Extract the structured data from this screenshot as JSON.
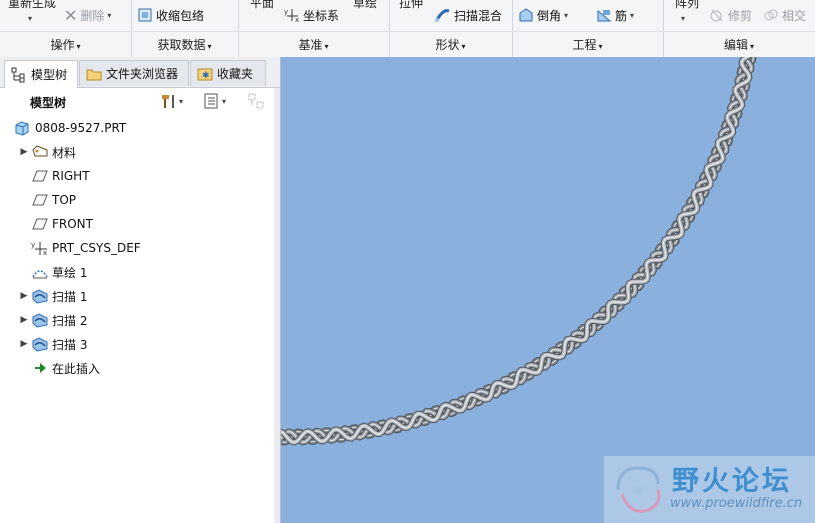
{
  "ribbon": {
    "groups": [
      {
        "title": "操作",
        "buttons": {
          "regenerate": "重新生成",
          "delete": "删除"
        }
      },
      {
        "title": "获取数据",
        "buttons": {
          "shrinkwrap": "收缩包络"
        }
      },
      {
        "title": "基准",
        "buttons": {
          "plane": "平面",
          "csys": "坐标系",
          "sketch": "草绘"
        }
      },
      {
        "title": "形状",
        "buttons": {
          "extrude": "拉伸",
          "swept_blend": "扫描混合"
        }
      },
      {
        "title": "工程",
        "buttons": {
          "chamfer": "倒角",
          "rib": "筋"
        }
      },
      {
        "title": "编辑",
        "buttons": {
          "pattern": "阵列",
          "trim": "修剪",
          "intersect": "相交"
        }
      }
    ]
  },
  "left_panel": {
    "tabs": [
      {
        "label": "模型树",
        "icon": "model-tree-icon",
        "active": true
      },
      {
        "label": "文件夹浏览器",
        "icon": "folder-icon",
        "active": false
      },
      {
        "label": "收藏夹",
        "icon": "favorites-icon",
        "active": false
      }
    ],
    "tree_title": "模型树",
    "tree": [
      {
        "label": "0808-9527.PRT",
        "icon": "part-icon",
        "expandable": false
      },
      {
        "label": "材料",
        "icon": "material-icon",
        "expandable": true
      },
      {
        "label": "RIGHT",
        "icon": "datum-plane-icon",
        "expandable": false
      },
      {
        "label": "TOP",
        "icon": "datum-plane-icon",
        "expandable": false
      },
      {
        "label": "FRONT",
        "icon": "datum-plane-icon",
        "expandable": false
      },
      {
        "label": "PRT_CSYS_DEF",
        "icon": "csys-icon",
        "expandable": false
      },
      {
        "label": "草绘 1",
        "icon": "sketch-icon",
        "expandable": false
      },
      {
        "label": "扫描 1",
        "icon": "sweep-icon",
        "expandable": true
      },
      {
        "label": "扫描 2",
        "icon": "sweep-icon",
        "expandable": true
      },
      {
        "label": "扫描 3",
        "icon": "sweep-icon",
        "expandable": true
      },
      {
        "label": "在此插入",
        "icon": "insert-here-icon",
        "expandable": false
      }
    ]
  },
  "viewport": {
    "background": "#8ab0dd",
    "model": "twisted-rope-sweep"
  },
  "watermark": {
    "title": "野火论坛",
    "url": "www.proewildfire.cn"
  }
}
